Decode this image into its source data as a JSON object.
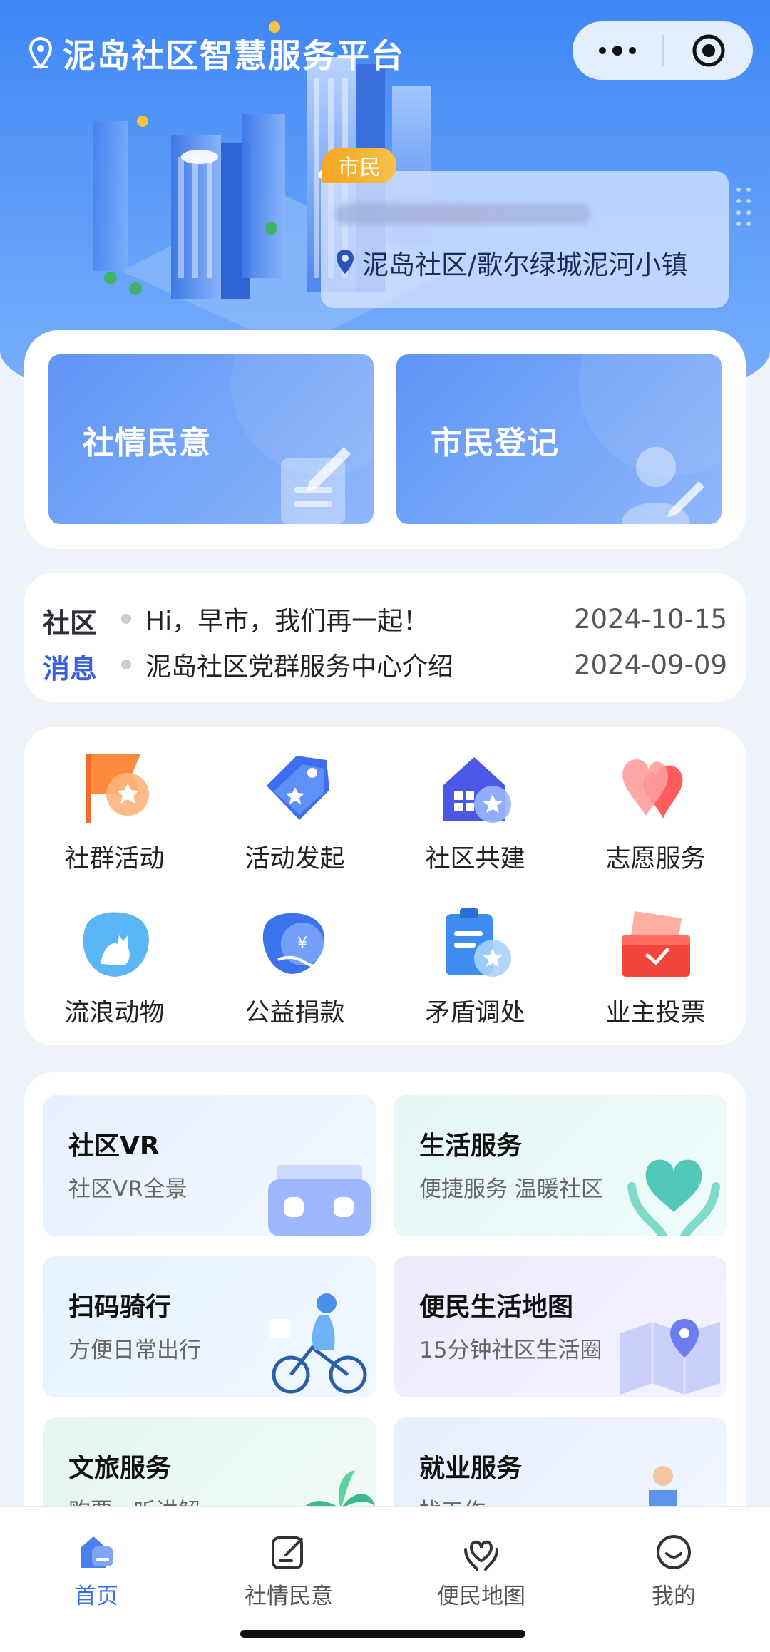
{
  "header": {
    "app_title": "泥岛社区智慧服务平台",
    "role_badge": "市民",
    "community_address": "泥岛社区/歌尔绿城泥河小镇"
  },
  "quick_actions": [
    {
      "label": "社情民意"
    },
    {
      "label": "市民登记"
    }
  ],
  "news": {
    "logo_line1": "社区",
    "logo_line2": "消息",
    "items": [
      {
        "title": "Hi，早市，我们再一起！",
        "date": "2024-10-15"
      },
      {
        "title": "泥岛社区党群服务中心介绍",
        "date": "2024-09-09"
      }
    ]
  },
  "services": [
    {
      "label": "社群活动",
      "icon": "flag-star-icon"
    },
    {
      "label": "活动发起",
      "icon": "tag-star-icon"
    },
    {
      "label": "社区共建",
      "icon": "house-star-icon"
    },
    {
      "label": "志愿服务",
      "icon": "hearts-icon"
    },
    {
      "label": "流浪动物",
      "icon": "cat-icon"
    },
    {
      "label": "公益捐款",
      "icon": "donation-icon"
    },
    {
      "label": "矛盾调处",
      "icon": "clipboard-star-icon"
    },
    {
      "label": "业主投票",
      "icon": "ballot-box-icon"
    }
  ],
  "features": [
    {
      "title": "社区VR",
      "subtitle": "社区VR全景",
      "icon": "vr-headset-icon"
    },
    {
      "title": "生活服务",
      "subtitle": "便捷服务 温暖社区",
      "icon": "heart-hands-icon"
    },
    {
      "title": "扫码骑行",
      "subtitle": "方便日常出行",
      "icon": "cyclist-icon"
    },
    {
      "title": "便民生活地图",
      "subtitle": "15分钟社区生活圈",
      "icon": "map-pin-icon"
    },
    {
      "title": "文旅服务",
      "subtitle": "购票 · 听讲解",
      "icon": "palm-tree-icon"
    },
    {
      "title": "就业服务",
      "subtitle": "找工作",
      "icon": "worker-icon"
    }
  ],
  "tabbar": [
    {
      "label": "首页",
      "icon": "home-icon",
      "active": true
    },
    {
      "label": "社情民意",
      "icon": "edit-note-icon",
      "active": false
    },
    {
      "label": "便民地图",
      "icon": "heart-hand-icon",
      "active": false
    },
    {
      "label": "我的",
      "icon": "smile-icon",
      "active": false
    }
  ],
  "colors": {
    "primary": "#3a6fe8",
    "hero_top": "#3e86f5",
    "badge": "#f5a623"
  }
}
